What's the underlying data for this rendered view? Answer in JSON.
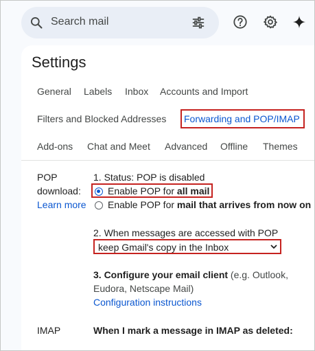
{
  "search": {
    "placeholder": "Search mail"
  },
  "icons": {
    "search": "search-icon",
    "filter": "tune-icon",
    "help": "help-icon",
    "settings": "gear-icon",
    "gemini": "sparkle-icon"
  },
  "page": {
    "title": "Settings"
  },
  "tabs": {
    "row1": [
      "General",
      "Labels",
      "Inbox",
      "Accounts and Import"
    ],
    "row2": [
      "Filters and Blocked Addresses",
      "Forwarding and POP/IMAP"
    ],
    "row3": [
      "Add-ons",
      "Chat and Meet",
      "Advanced",
      "Offline",
      "Themes"
    ],
    "active": "Forwarding and POP/IMAP"
  },
  "pop": {
    "label_line1": "POP",
    "label_line2": "download:",
    "learn_more": "Learn more",
    "status_heading": "1. Status: POP is disabled",
    "option_all_prefix": "Enable POP for ",
    "option_all_bold": "all mail",
    "option_now_prefix": "Enable POP for ",
    "option_now_bold": "mail that arrives from now on",
    "accessed_heading": "2. When messages are accessed with POP",
    "accessed_value": "keep Gmail's copy in the Inbox",
    "configure_heading": "3. Configure your email client",
    "configure_note": " (e.g. Outlook,",
    "configure_note2": "Eudora, Netscape Mail)",
    "configuration_link": "Configuration instructions"
  },
  "imap": {
    "label": "IMAP",
    "deleted_heading": "When I mark a message in IMAP as deleted:"
  },
  "colors": {
    "accent": "#0b57d0",
    "highlight_box": "#c5221f",
    "search_bg": "#e9eef6"
  }
}
